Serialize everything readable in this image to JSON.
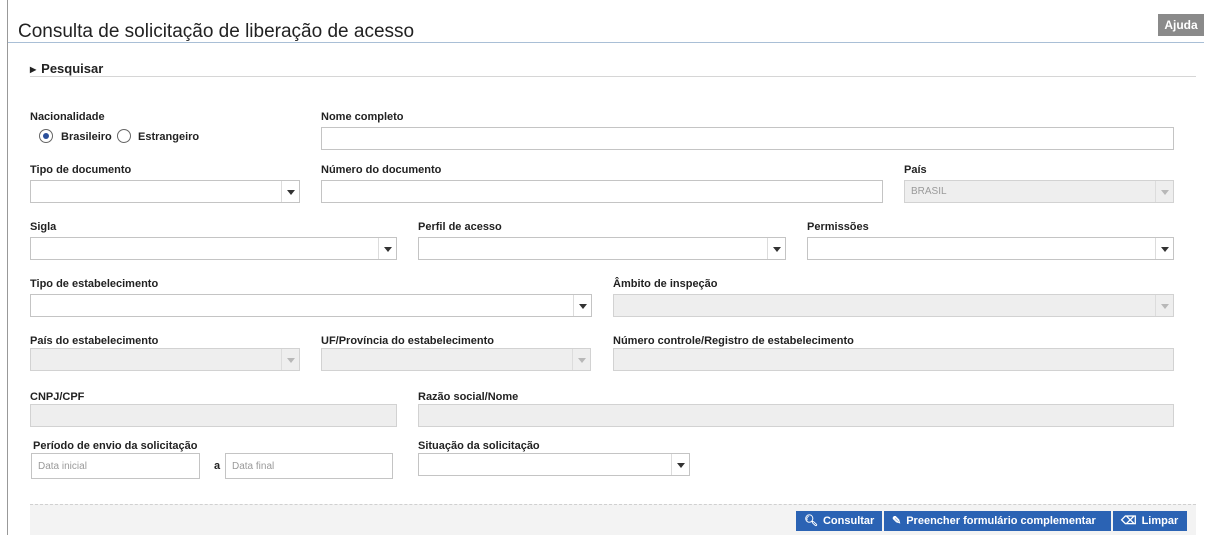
{
  "header": {
    "title": "Consulta de solicitação de liberação de acesso",
    "help_label": "Ajuda"
  },
  "section": {
    "label": "Pesquisar"
  },
  "form": {
    "nacionalidade": {
      "label": "Nacionalidade",
      "options": [
        "Brasileiro",
        "Estrangeiro"
      ],
      "selected": "Brasileiro"
    },
    "nome_completo": {
      "label": "Nome completo",
      "value": ""
    },
    "tipo_documento": {
      "label": "Tipo de documento",
      "value": ""
    },
    "numero_documento": {
      "label": "Número do documento",
      "value": ""
    },
    "pais": {
      "label": "País",
      "value": "BRASIL"
    },
    "sigla": {
      "label": "Sigla",
      "value": ""
    },
    "perfil_acesso": {
      "label": "Perfil de acesso",
      "value": ""
    },
    "permissoes": {
      "label": "Permissões",
      "value": ""
    },
    "tipo_estabelecimento": {
      "label": "Tipo de estabelecimento",
      "value": ""
    },
    "ambito_inspecao": {
      "label": "Âmbito de inspeção",
      "value": ""
    },
    "pais_estabelecimento": {
      "label": "País do estabelecimento",
      "value": ""
    },
    "uf_provincia": {
      "label": "UF/Província do estabelecimento",
      "value": ""
    },
    "numero_controle": {
      "label": "Número controle/Registro de estabelecimento",
      "value": ""
    },
    "cnpj_cpf": {
      "label": "CNPJ/CPF",
      "value": ""
    },
    "razao_social": {
      "label": "Razão social/Nome",
      "value": ""
    },
    "periodo_envio": {
      "label": "Período de envio da solicitação",
      "start_placeholder": "Data inicial",
      "separator": "a",
      "end_placeholder": "Data final"
    },
    "situacao": {
      "label": "Situação da solicitação",
      "value": ""
    }
  },
  "actions": {
    "consultar": "Consultar",
    "preencher": "Preencher formulário complementar",
    "limpar": "Limpar"
  },
  "colors": {
    "primary_button": "#2b63b4",
    "help_button": "#8a8a8a",
    "radio_selected": "#2a4f9a"
  }
}
